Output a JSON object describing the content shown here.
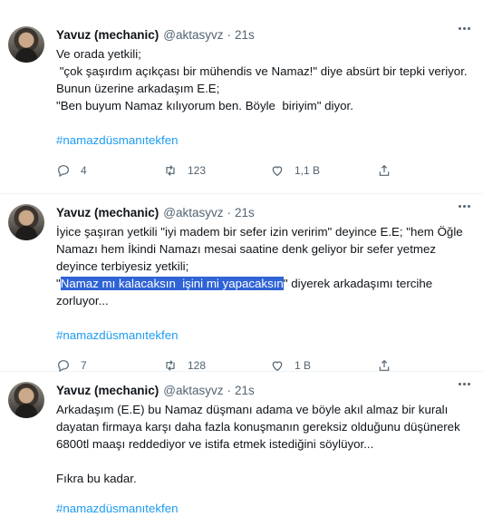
{
  "tweets": [
    {
      "name": "Yavuz (mechanic)",
      "handle": "@aktasyvz",
      "separator": "·",
      "time": "21s",
      "text": "Ve orada yetkili;\n \"çok şaşırdım açıkçası bir mühendis ve Namaz!\" diye absürt bir tepki veriyor.\nBunun üzerine arkadaşım E.E;\n\"Ben buyum Namaz kılıyorum ben. Böyle  biriyim\" diyor.",
      "hashtag": "#namazdüsmanıtekfen",
      "replies": "4",
      "retweets": "123",
      "likes": "1,1 B"
    },
    {
      "name": "Yavuz (mechanic)",
      "handle": "@aktasyvz",
      "separator": "·",
      "time": "21s",
      "text_before": "İyice şaşıran yetkili \"iyi madem bir sefer izin veririm\" deyince E.E; \"hem Öğle Namazı hem İkindi Namazı mesai saatine denk geliyor bir sefer yetmez deyince terbiyesiz yetkili;\n\"",
      "text_highlight": "Namaz mı kalacaksın  işini mi yapacaksın",
      "text_after": "\" diyerek arkadaşımı tercihe zorluyor...",
      "hashtag": "#namazdüsmanıtekfen",
      "replies": "7",
      "retweets": "128",
      "likes": "1 B"
    },
    {
      "name": "Yavuz (mechanic)",
      "handle": "@aktasyvz",
      "separator": "·",
      "time": "21s",
      "text": "Arkadaşım (E.E) bu Namaz düşmanı adama ve böyle akıl almaz bir kuralı dayatan firmaya karşı daha fazla konuşmanın gereksiz olduğunu düşünerek 6800tl maaşı reddediyor ve istifa etmek istediğini söylüyor...\n\nFıkra bu kadar.",
      "hashtag": "#namazdüsmanıtekfen"
    }
  ],
  "colors": {
    "accent": "#1d9bf0",
    "highlight": "#2f63d6",
    "muted": "#536471",
    "text": "#0f1419"
  },
  "icons": [
    "reply-icon",
    "retweet-icon",
    "like-icon",
    "share-icon",
    "more-icon"
  ]
}
